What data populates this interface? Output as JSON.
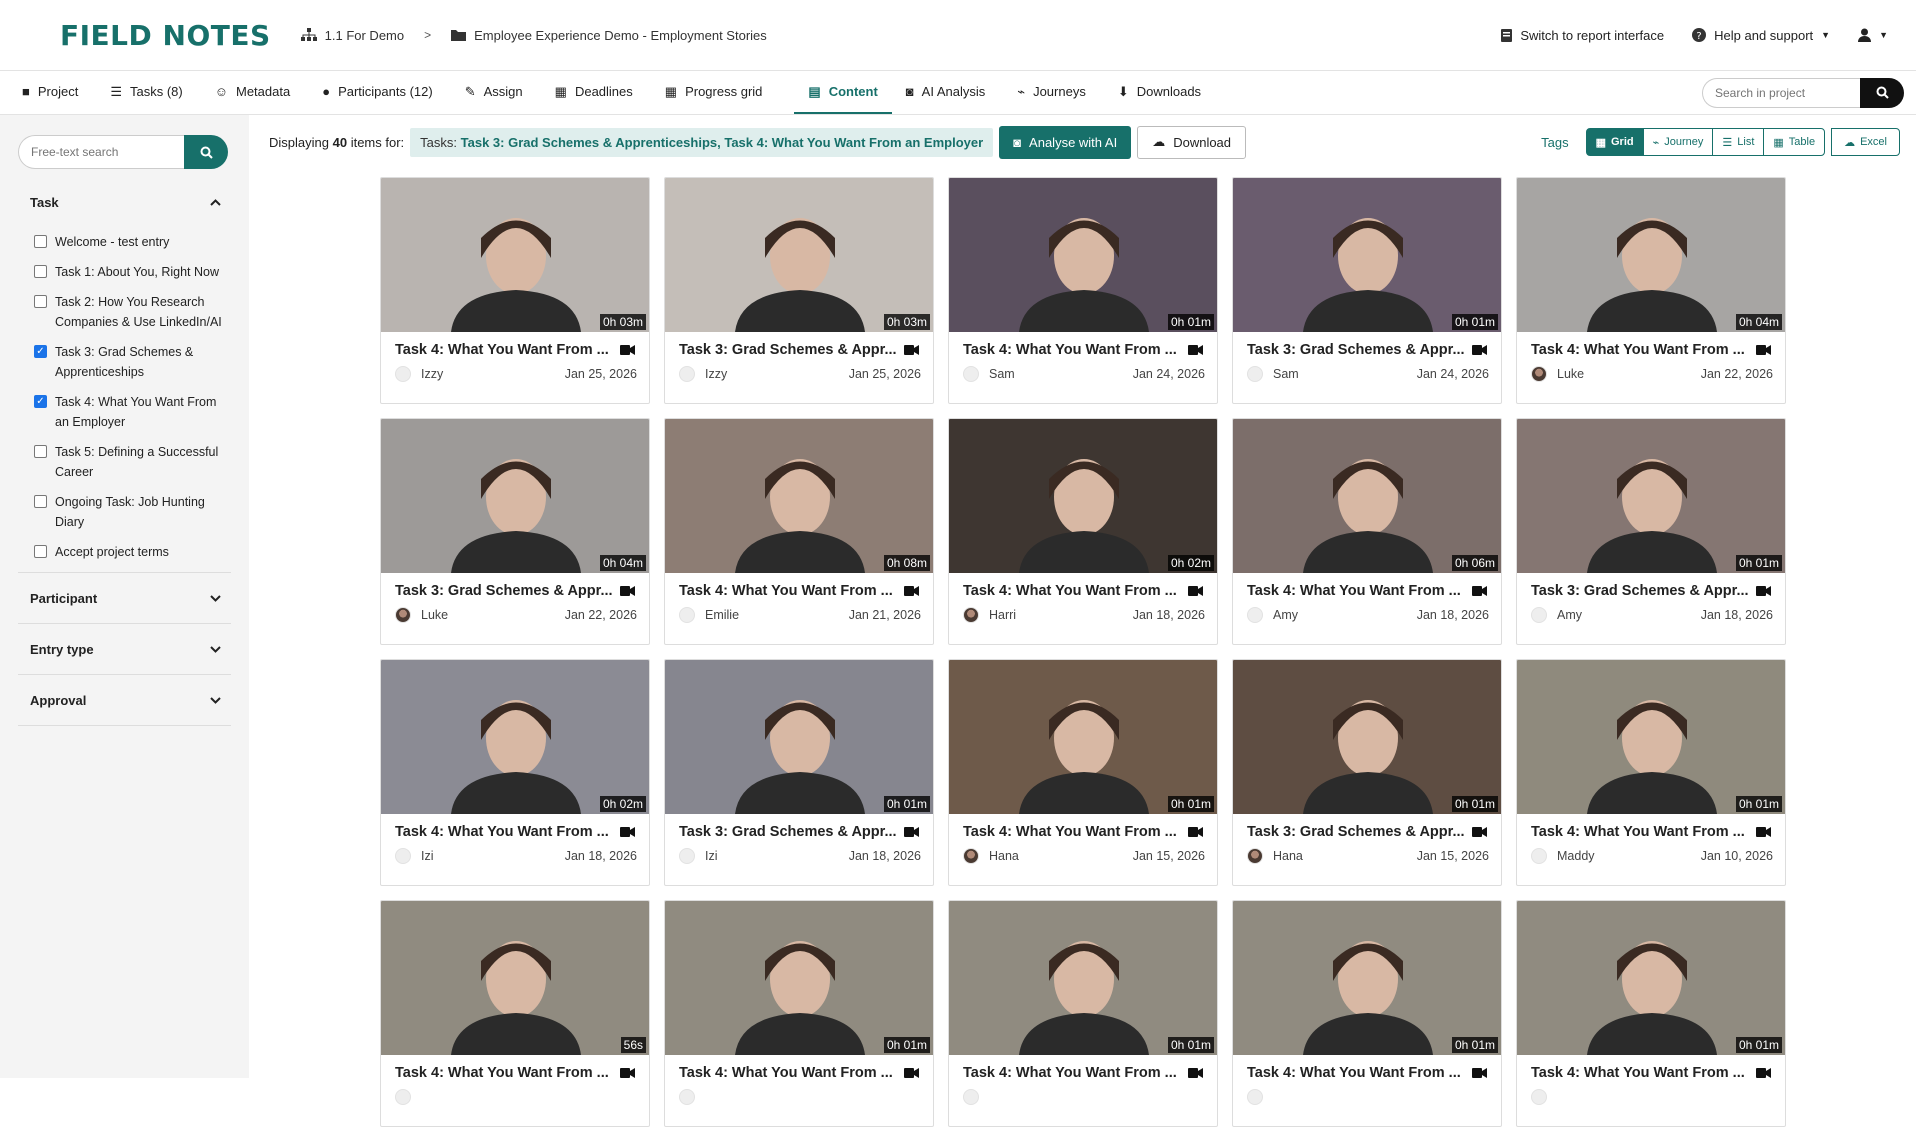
{
  "brand": "FIELD NOTES",
  "breadcrumb": {
    "project": "1.1 For Demo",
    "study": "Employee Experience Demo - Employment Stories"
  },
  "topright": {
    "switch": "Switch to report interface",
    "help": "Help and support"
  },
  "nav": [
    {
      "label": "Project",
      "icon": "folder-icon"
    },
    {
      "label": "Tasks (8)",
      "icon": "list-icon"
    },
    {
      "label": "Metadata",
      "icon": "user-tag-icon"
    },
    {
      "label": "Participants (12)",
      "icon": "user-icon"
    },
    {
      "label": "Assign",
      "icon": "pen-icon"
    },
    {
      "label": "Deadlines",
      "icon": "calendar-icon"
    },
    {
      "label": "Progress grid",
      "icon": "grid-icon"
    },
    {
      "label": "Content",
      "icon": "content-icon"
    },
    {
      "label": "AI Analysis",
      "icon": "robot-icon"
    },
    {
      "label": "Journeys",
      "icon": "chart-icon"
    },
    {
      "label": "Downloads",
      "icon": "download-icon"
    }
  ],
  "nav_search_placeholder": "Search in project",
  "sidebar": {
    "search_placeholder": "Free-text search",
    "task_heading": "Task",
    "tasks": [
      {
        "label": "Welcome - test entry",
        "checked": false
      },
      {
        "label": "Task 1: About You, Right Now",
        "checked": false
      },
      {
        "label": "Task 2: How You Research Companies & Use LinkedIn/AI",
        "checked": false
      },
      {
        "label": "Task 3: Grad Schemes & Apprenticeships",
        "checked": true
      },
      {
        "label": "Task 4: What You Want From an Employer",
        "checked": true
      },
      {
        "label": "Task 5: Defining a Successful Career",
        "checked": false
      },
      {
        "label": "Ongoing Task: Job Hunting Diary",
        "checked": false
      },
      {
        "label": "Accept project terms",
        "checked": false
      }
    ],
    "sections": [
      "Participant",
      "Entry type",
      "Approval"
    ]
  },
  "toolbar": {
    "displaying_pre": "Displaying",
    "count": "40",
    "displaying_post": "items for:",
    "filter_label": "Tasks:",
    "filter_value": "Task 3: Grad Schemes & Apprenticeships, Task 4: What You Want From an Employer",
    "analyse": "Analyse with AI",
    "download": "Download",
    "tags": "Tags",
    "views": [
      "Grid",
      "Journey",
      "List",
      "Table"
    ],
    "excel": "Excel"
  },
  "cards": [
    {
      "title": "Task 4: What You Want From ...",
      "name": "Izzy",
      "date": "Jan 25, 2026",
      "dur": "0h 03m",
      "photo": false,
      "bg": "#b9b4b0"
    },
    {
      "title": "Task 3: Grad Schemes & Appr...",
      "name": "Izzy",
      "date": "Jan 25, 2026",
      "dur": "0h 03m",
      "photo": false,
      "bg": "#c4beb8"
    },
    {
      "title": "Task 4: What You Want From ...",
      "name": "Sam",
      "date": "Jan 24, 2026",
      "dur": "0h 01m",
      "photo": false,
      "bg": "#5a4f5e"
    },
    {
      "title": "Task 3: Grad Schemes & Appr...",
      "name": "Sam",
      "date": "Jan 24, 2026",
      "dur": "0h 01m",
      "photo": false,
      "bg": "#6a5c6e"
    },
    {
      "title": "Task 4: What You Want From ...",
      "name": "Luke",
      "date": "Jan 22, 2026",
      "dur": "0h 04m",
      "photo": true,
      "bg": "#a7a5a3"
    },
    {
      "title": "Task 3: Grad Schemes & Appr...",
      "name": "Luke",
      "date": "Jan 22, 2026",
      "dur": "0h 04m",
      "photo": true,
      "bg": "#9d9a98"
    },
    {
      "title": "Task 4: What You Want From ...",
      "name": "Emilie",
      "date": "Jan 21, 2026",
      "dur": "0h 08m",
      "photo": false,
      "bg": "#8d7d74"
    },
    {
      "title": "Task 4: What You Want From ...",
      "name": "Harri",
      "date": "Jan 18, 2026",
      "dur": "0h 02m",
      "photo": true,
      "bg": "#3e3631"
    },
    {
      "title": "Task 4: What You Want From ...",
      "name": "Amy",
      "date": "Jan 18, 2026",
      "dur": "0h 06m",
      "photo": false,
      "bg": "#7c6e6a"
    },
    {
      "title": "Task 3: Grad Schemes & Appr...",
      "name": "Amy",
      "date": "Jan 18, 2026",
      "dur": "0h 01m",
      "photo": false,
      "bg": "#857672"
    },
    {
      "title": "Task 4: What You Want From ...",
      "name": "Izi",
      "date": "Jan 18, 2026",
      "dur": "0h 02m",
      "photo": false,
      "bg": "#8b8b94"
    },
    {
      "title": "Task 3: Grad Schemes & Appr...",
      "name": "Izi",
      "date": "Jan 18, 2026",
      "dur": "0h 01m",
      "photo": false,
      "bg": "#86868f"
    },
    {
      "title": "Task 4: What You Want From ...",
      "name": "Hana",
      "date": "Jan 15, 2026",
      "dur": "0h 01m",
      "photo": true,
      "bg": "#6e5a4a"
    },
    {
      "title": "Task 3: Grad Schemes & Appr...",
      "name": "Hana",
      "date": "Jan 15, 2026",
      "dur": "0h 01m",
      "photo": true,
      "bg": "#5e4d42"
    },
    {
      "title": "Task 4: What You Want From ...",
      "name": "Maddy",
      "date": "Jan 10, 2026",
      "dur": "0h 01m",
      "photo": false,
      "bg": "#8f8a7d"
    },
    {
      "title": "Task 4: What You Want From ...",
      "name": "",
      "date": "",
      "dur": "56s",
      "photo": false,
      "bg": "#908b80"
    },
    {
      "title": "Task 4: What You Want From ...",
      "name": "",
      "date": "",
      "dur": "0h 01m",
      "photo": false,
      "bg": "#908b80"
    },
    {
      "title": "Task 4: What You Want From ...",
      "name": "",
      "date": "",
      "dur": "0h 01m",
      "photo": false,
      "bg": "#908b80"
    },
    {
      "title": "Task 4: What You Want From ...",
      "name": "",
      "date": "",
      "dur": "0h 01m",
      "photo": false,
      "bg": "#908b80"
    },
    {
      "title": "Task 4: What You Want From ...",
      "name": "",
      "date": "",
      "dur": "0h 01m",
      "photo": false,
      "bg": "#908b80"
    }
  ],
  "colors": {
    "accent": "#17706a",
    "checkbox": "#1a73e8"
  }
}
